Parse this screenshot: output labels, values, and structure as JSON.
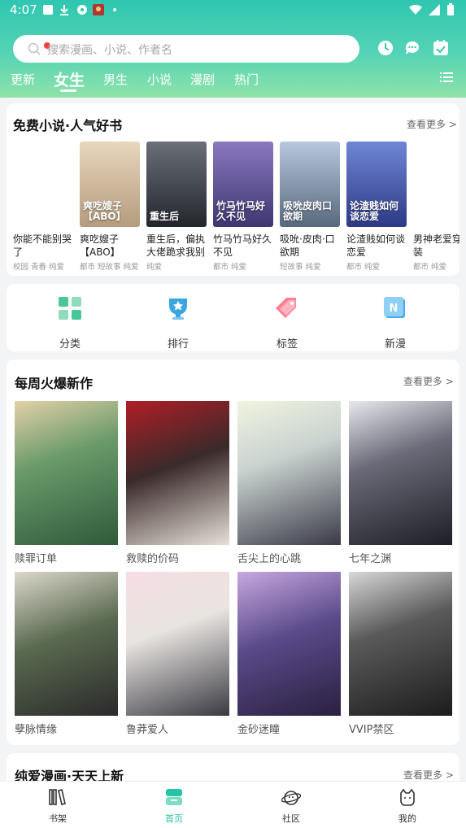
{
  "status_bar": {
    "time": "4:07"
  },
  "search": {
    "placeholder": "搜索漫画、小说、作者名"
  },
  "tabs": [
    {
      "label": "更新"
    },
    {
      "label": "女生"
    },
    {
      "label": "男生"
    },
    {
      "label": "小说"
    },
    {
      "label": "漫剧"
    },
    {
      "label": "热门"
    }
  ],
  "novels": {
    "title": "免费小说·人气好书",
    "more": "查看更多",
    "items": [
      {
        "name": "你能不能别哭了",
        "tags": "校园 青春 纯爱",
        "cover_text": "",
        "color": "#ffffff"
      },
      {
        "name": "爽吃嫂子【ABO】",
        "tags": "都市 短故事 纯爱",
        "cover_text": "爽吃嫂子【ABO】",
        "color": "#c9b49a"
      },
      {
        "name": "重生后，偏执大佬跪求我别",
        "tags": "纯爱",
        "cover_text": "重生后",
        "color": "#3a3f4a"
      },
      {
        "name": "竹马竹马好久不见",
        "tags": "都市 纯爱",
        "cover_text": "竹马竹马好久不见",
        "color": "#6a5c9a"
      },
      {
        "name": "吸吮·皮肉·口欲期",
        "tags": "短故事 纯爱",
        "cover_text": "吸吮皮肉口欲期",
        "color": "#7c8fa8"
      },
      {
        "name": "论渣贱如何谈恋爱",
        "tags": "都市 纯爱",
        "cover_text": "论渣贱如何谈恋爱",
        "color": "#5a6fb8"
      },
      {
        "name": "男神老爱穿女装",
        "tags": "都市 纯爱",
        "cover_text": "",
        "color": "#ffffff"
      }
    ]
  },
  "categories": [
    {
      "label": "分类",
      "icon": "category-icon",
      "color": "#3bbf8f"
    },
    {
      "label": "排行",
      "icon": "trophy-icon",
      "color": "#3aa6e0"
    },
    {
      "label": "标签",
      "icon": "tag-icon",
      "color": "#ff6f86"
    },
    {
      "label": "新漫",
      "icon": "new-manga-icon",
      "color": "#4aa8e8"
    }
  ],
  "weekly": {
    "title": "每周火爆新作",
    "more": "查看更多",
    "items": [
      {
        "name": "赎罪订单",
        "color": "#5f8f5a"
      },
      {
        "name": "救赎的价码",
        "color": "#5a2a2a"
      },
      {
        "name": "舌尖上的心跳",
        "color": "#c8d4c8"
      },
      {
        "name": "七年之渊",
        "color": "#3a3a42"
      },
      {
        "name": "孽脉情缘",
        "color": "#4e5a4a"
      },
      {
        "name": "鲁莽爱人",
        "color": "#e6e0dc"
      },
      {
        "name": "金砂迷瞳",
        "color": "#4a4070"
      },
      {
        "name": "VVIP禁区",
        "color": "#3a3a3a"
      }
    ]
  },
  "daily": {
    "title": "纯爱漫画·天天上新",
    "more": "查看更多"
  },
  "bottom_nav": [
    {
      "label": "书架",
      "icon": "bookshelf-icon"
    },
    {
      "label": "首页",
      "icon": "home-icon"
    },
    {
      "label": "社区",
      "icon": "community-icon"
    },
    {
      "label": "我的",
      "icon": "profile-icon"
    }
  ],
  "colors": {
    "accent": "#27c3a5",
    "header_top": "#2fc6b0",
    "header_bottom": "#8fe3a8"
  }
}
